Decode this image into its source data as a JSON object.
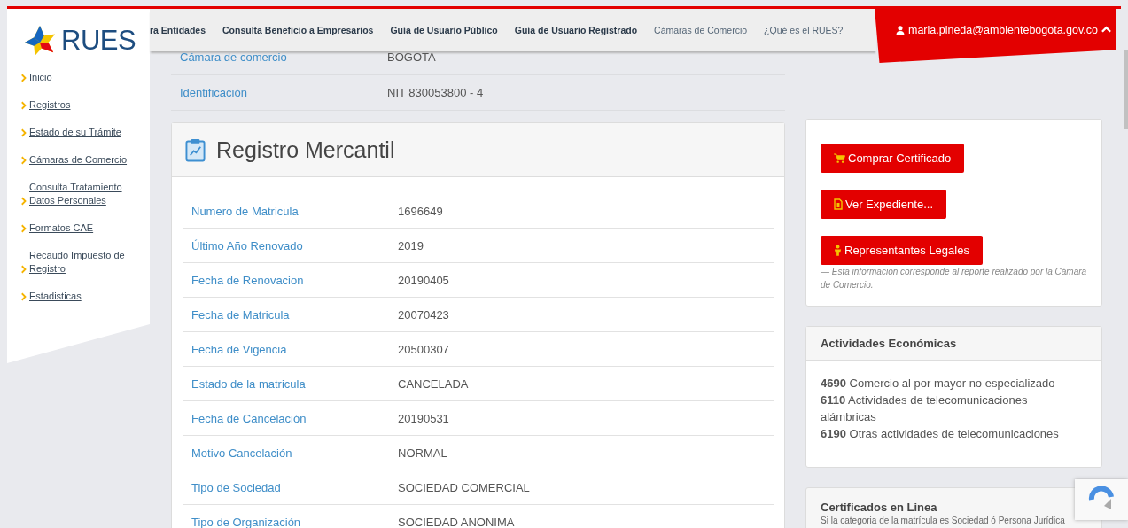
{
  "logo": {
    "text": "RUES"
  },
  "sidebar": {
    "items": [
      {
        "label": "Inicio"
      },
      {
        "label": "Registros"
      },
      {
        "label": "Estado de su Trámite"
      },
      {
        "label": "Cámaras de Comercio"
      },
      {
        "label": "Consulta Tratamiento Datos Personales"
      },
      {
        "label": "Formatos CAE"
      },
      {
        "label": "Recaudo Impuesto de Registro"
      },
      {
        "label": "Estadisticas"
      }
    ]
  },
  "nav": {
    "links": [
      {
        "label": "ra Entidades",
        "emphasized": true
      },
      {
        "label": "Consulta Beneficio a Empresarios",
        "emphasized": true
      },
      {
        "label": "Guía de Usuario Público",
        "emphasized": true
      },
      {
        "label": "Guía de Usuario Registrado",
        "emphasized": true
      },
      {
        "label": "Cámaras de Comercio",
        "emphasized": false
      },
      {
        "label": "¿Qué es el RUES?",
        "emphasized": false
      }
    ],
    "user": {
      "email": "maria.pineda@ambientebogota.gov.co",
      "expanded": true
    }
  },
  "summary": [
    {
      "label": "Cámara de comercio",
      "value": "BOGOTA"
    },
    {
      "label": "Identificación",
      "value": "NIT 830053800 - 4"
    }
  ],
  "registro": {
    "title": "Registro Mercantil",
    "rows": [
      {
        "label": "Numero de Matricula",
        "value": "1696649"
      },
      {
        "label": "Último Año Renovado",
        "value": "2019"
      },
      {
        "label": "Fecha de Renovacion",
        "value": "20190405"
      },
      {
        "label": "Fecha de Matricula",
        "value": "20070423"
      },
      {
        "label": "Fecha de Vigencia",
        "value": "20500307"
      },
      {
        "label": "Estado de la matricula",
        "value": "CANCELADA"
      },
      {
        "label": "Fecha de Cancelación",
        "value": "20190531"
      },
      {
        "label": "Motivo Cancelación",
        "value": "NORMAL"
      },
      {
        "label": "Tipo de Sociedad",
        "value": "SOCIEDAD COMERCIAL"
      },
      {
        "label": "Tipo de Organización",
        "value": "SOCIEDAD ANONIMA"
      }
    ]
  },
  "actions": {
    "buttons": [
      {
        "label": "Comprar Certificado",
        "kind": "cart"
      },
      {
        "label": "Ver Expediente...",
        "kind": "file"
      },
      {
        "label": "Representantes Legales",
        "kind": "person"
      }
    ],
    "note": "— Esta información corresponde al reporte realizado por la Cámara de Comercio."
  },
  "actividades": {
    "title": "Actividades Económicas",
    "items": [
      "**4690** Comercio al por mayor no especializado",
      "**6110** Actividades de telecomunicaciones alámbricas",
      "**6190** Otras actividades de telecomunicaciones"
    ]
  },
  "certificados": {
    "title": "Certificados en Linea",
    "text": "Si la categoria de la matrícula es Sociedad ó Persona Jurídica"
  }
}
